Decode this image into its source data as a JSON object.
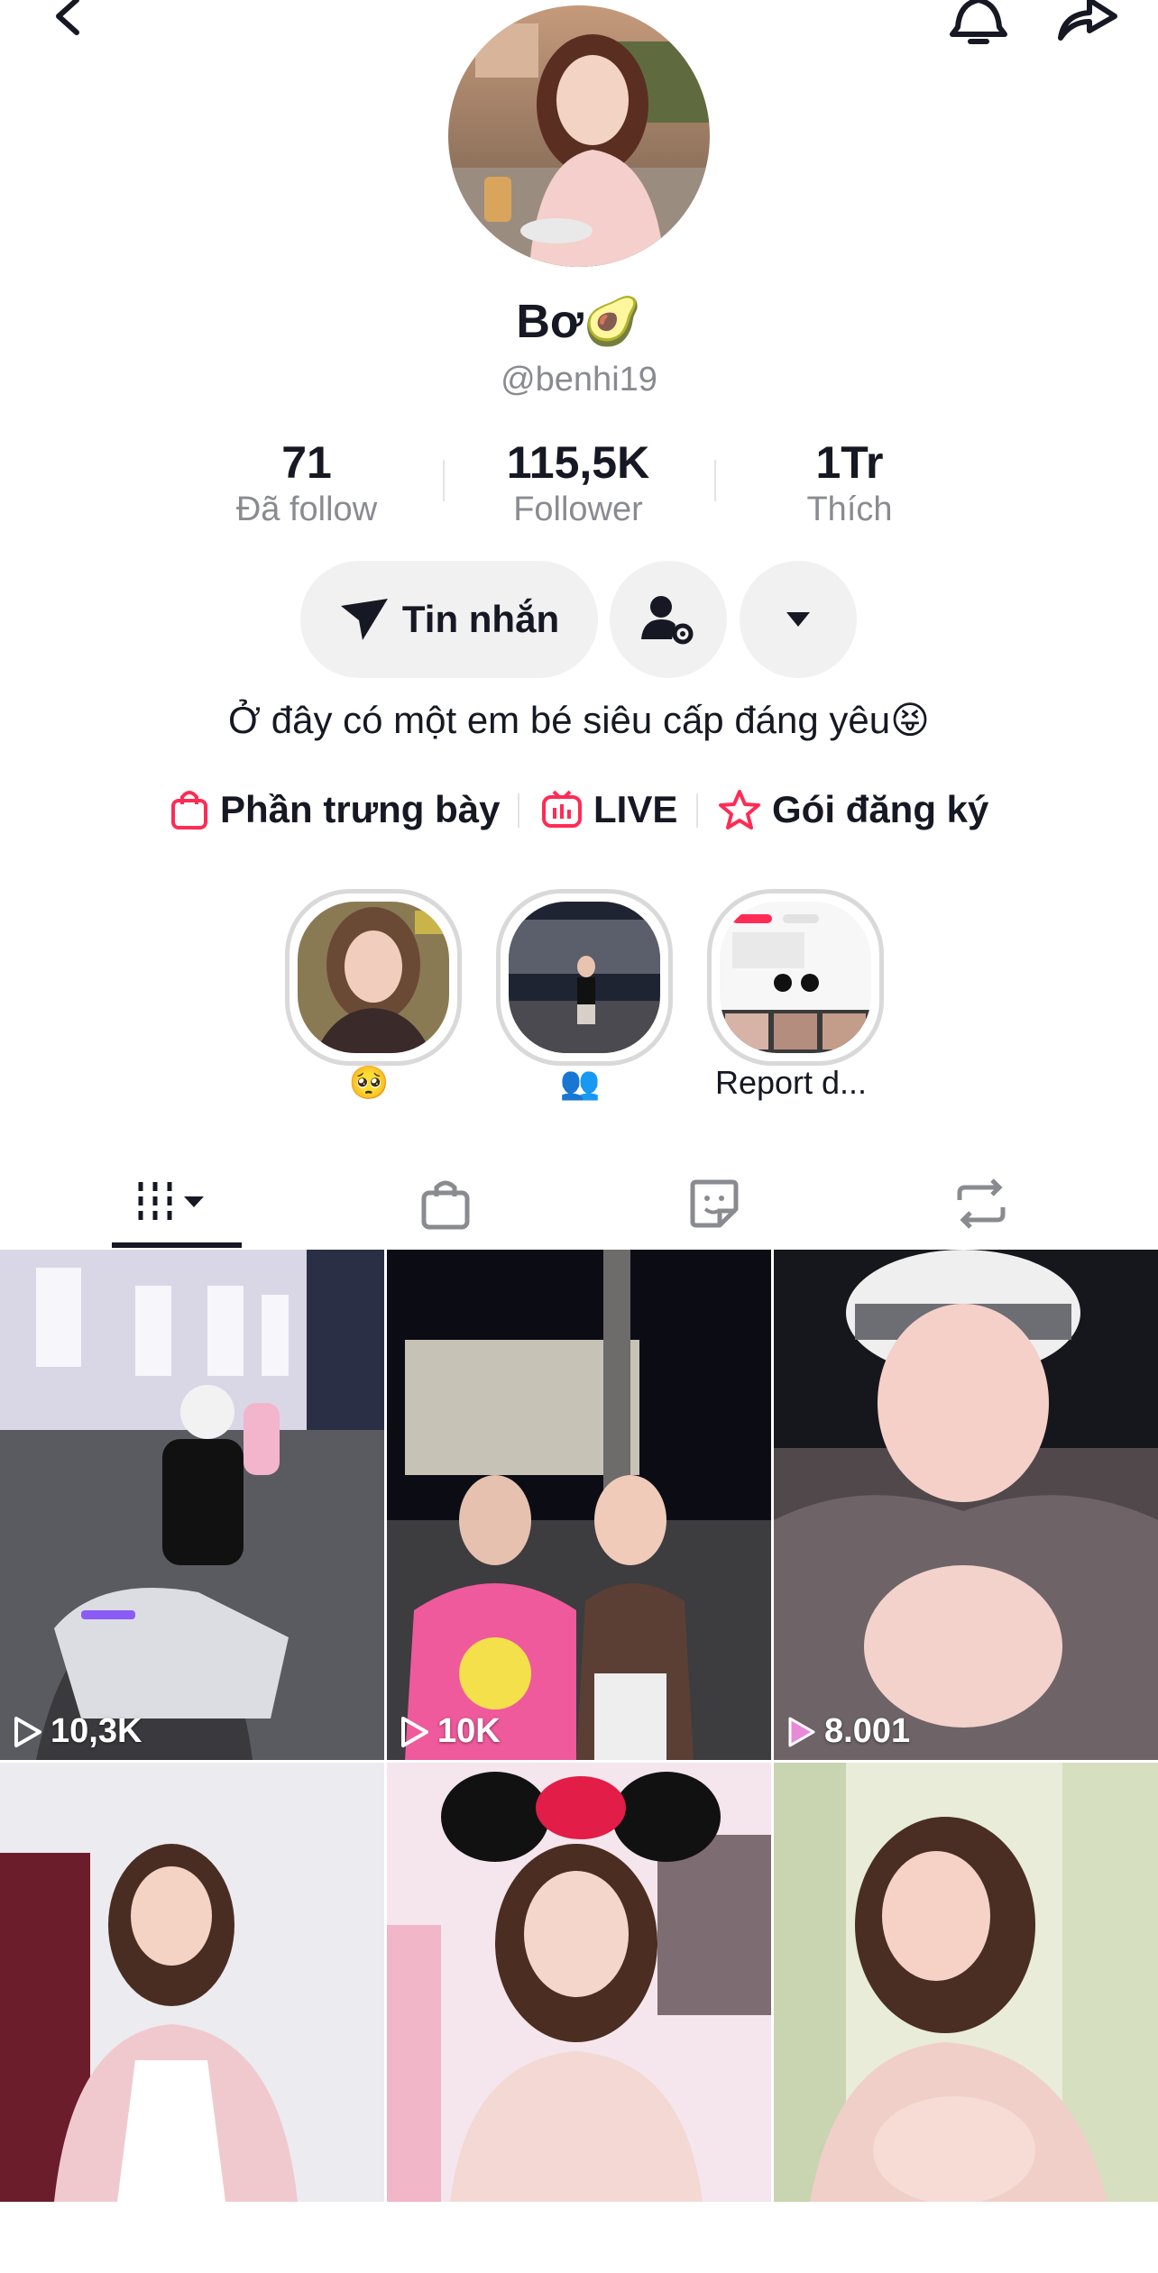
{
  "header": {
    "back": "chevron-left-icon",
    "bell": "bell-icon",
    "share": "share-icon"
  },
  "profile": {
    "name": "Bơ🥑",
    "handle": "@benhi19",
    "bio": "Ở đây có một em bé siêu cấp đáng yêu😝"
  },
  "stats": [
    {
      "value": "71",
      "label": "Đã follow"
    },
    {
      "value": "115,5K",
      "label": "Follower"
    },
    {
      "value": "1Tr",
      "label": "Thích"
    }
  ],
  "actions": {
    "message_label": "Tin nhắn"
  },
  "links": [
    {
      "label": "Phần trưng bày",
      "icon": "shopping-bag-icon"
    },
    {
      "label": "LIVE",
      "icon": "live-tv-icon"
    },
    {
      "label": "Gói đăng ký",
      "icon": "star-subscription-icon"
    }
  ],
  "highlights": [
    {
      "label": "🥺"
    },
    {
      "label": "👥"
    },
    {
      "label": "Report d..."
    }
  ],
  "tabs": [
    "videos-grid-icon",
    "shop-bag-icon",
    "liked-sticker-icon",
    "repost-icon"
  ],
  "videos": [
    {
      "views": "10,3K"
    },
    {
      "views": "10K"
    },
    {
      "views": "8.001"
    },
    {
      "views": ""
    },
    {
      "views": ""
    },
    {
      "views": ""
    }
  ],
  "colors": {
    "accent": "#fe2c55",
    "text": "#161823",
    "muted": "#8a8b91",
    "pill": "#f1f1f2"
  }
}
